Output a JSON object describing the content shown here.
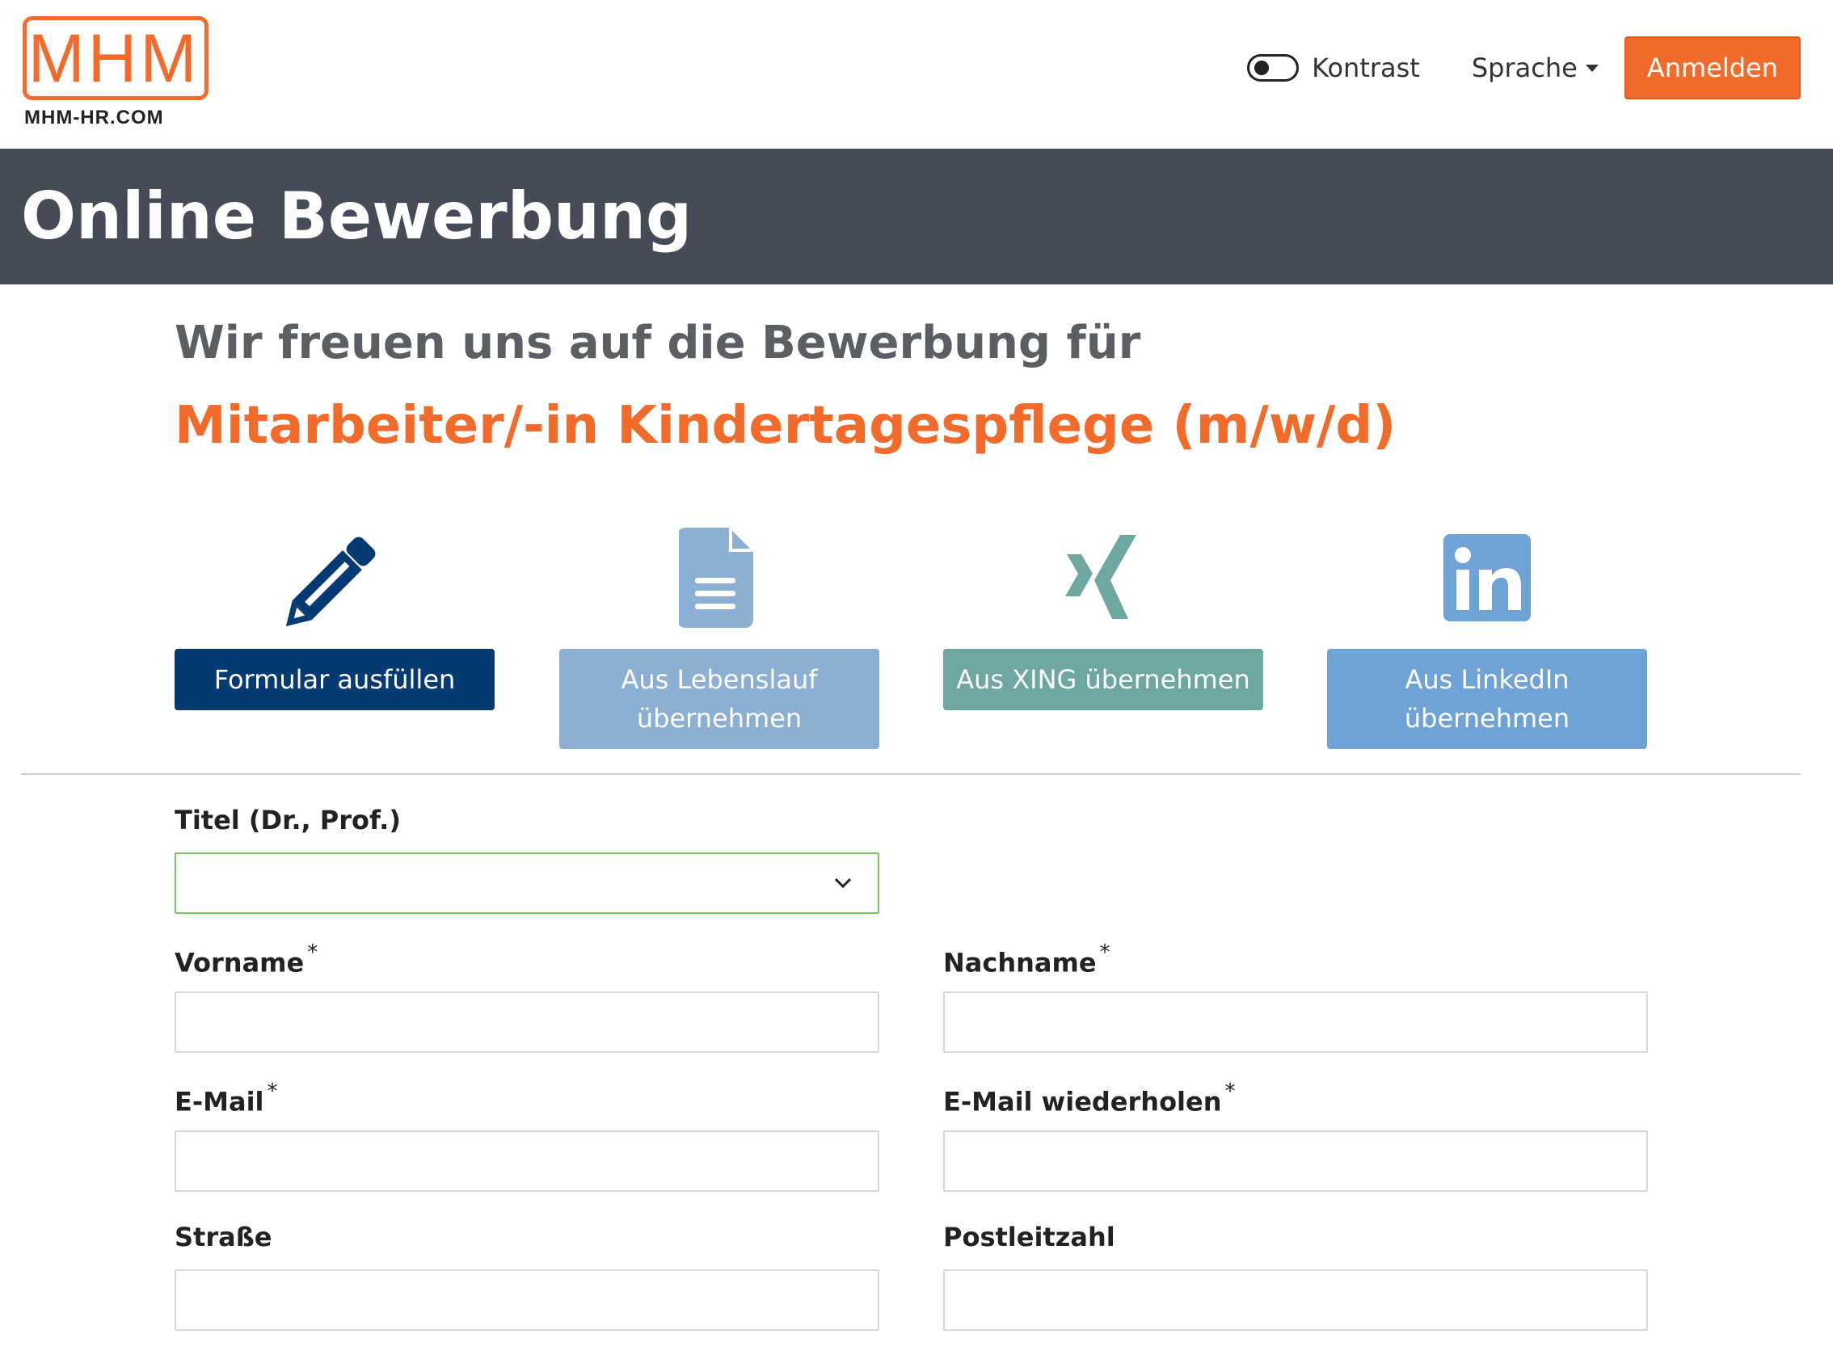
{
  "header": {
    "logo_letters": "MHM",
    "logo_sub": "MHM-HR.COM",
    "contrast_label": "Kontrast",
    "language_label": "Sprache",
    "login_label": "Anmelden"
  },
  "banner": {
    "title": "Online Bewerbung"
  },
  "intro": {
    "lead": "Wir freuen uns auf die Bewerbung für",
    "job_title": "Mitarbeiter/-in Kindertagespflege (m/w/d)"
  },
  "options": [
    {
      "label": "Formular ausfüllen",
      "icon": "pencil-icon",
      "color": "#063a73"
    },
    {
      "label": "Aus Lebenslauf übernehmen",
      "icon": "document-icon",
      "color": "#8cb0d3"
    },
    {
      "label": "Aus XING übernehmen",
      "icon": "xing-icon",
      "color": "#6ea7a1"
    },
    {
      "label": "Aus LinkedIn übernehmen",
      "icon": "linkedin-icon",
      "color": "#6fa3d5"
    }
  ],
  "form": {
    "title_label": "Titel (Dr., Prof.)",
    "title_value": "",
    "firstname_label": "Vorname",
    "lastname_label": "Nachname",
    "email_label": "E-Mail",
    "email_repeat_label": "E-Mail wiederholen",
    "street_label": "Straße",
    "zip_label": "Postleitzahl",
    "required_mark": "*"
  },
  "colors": {
    "accent": "#f26b2b",
    "banner": "#454c57"
  }
}
